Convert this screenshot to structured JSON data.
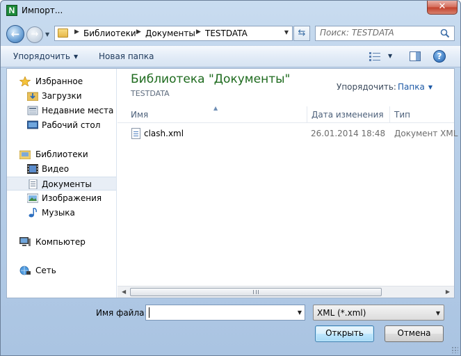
{
  "window": {
    "title": "Импорт...",
    "app_icon_letter": "N",
    "close_label": "✕"
  },
  "address": {
    "crumbs": [
      "Библиотеки",
      "Документы",
      "TESTDATA"
    ],
    "search_placeholder": "Поиск: TESTDATA"
  },
  "toolbar": {
    "organize_label": "Упорядочить",
    "new_folder_label": "Новая папка",
    "help_label": "?"
  },
  "sidebar": {
    "favorites": {
      "label": "Избранное",
      "items": [
        "Загрузки",
        "Недавние места",
        "Рабочий стол"
      ]
    },
    "libraries": {
      "label": "Библиотеки",
      "items": [
        "Видео",
        "Документы",
        "Изображения",
        "Музыка"
      ],
      "selected": "Документы"
    },
    "computer": "Компьютер",
    "network": "Сеть"
  },
  "content": {
    "library_title": "Библиотека \"Документы\"",
    "library_subtitle": "TESTDATA",
    "arrange_label": "Упорядочить:",
    "arrange_value": "Папка",
    "columns": {
      "name": "Имя",
      "date": "Дата изменения",
      "type": "Тип"
    },
    "files": [
      {
        "name": "clash.xml",
        "date": "26.01.2014 18:48",
        "type": "Документ XML"
      }
    ]
  },
  "footer": {
    "filename_label": "Имя файла:",
    "filename_value": "",
    "filetype_value": "XML (*.xml)",
    "open_label": "Открыть",
    "cancel_label": "Отмена"
  },
  "colors": {
    "library_title": "#1d6a1d",
    "accent": "#1e5aa6",
    "selection": "#e8eef6"
  }
}
